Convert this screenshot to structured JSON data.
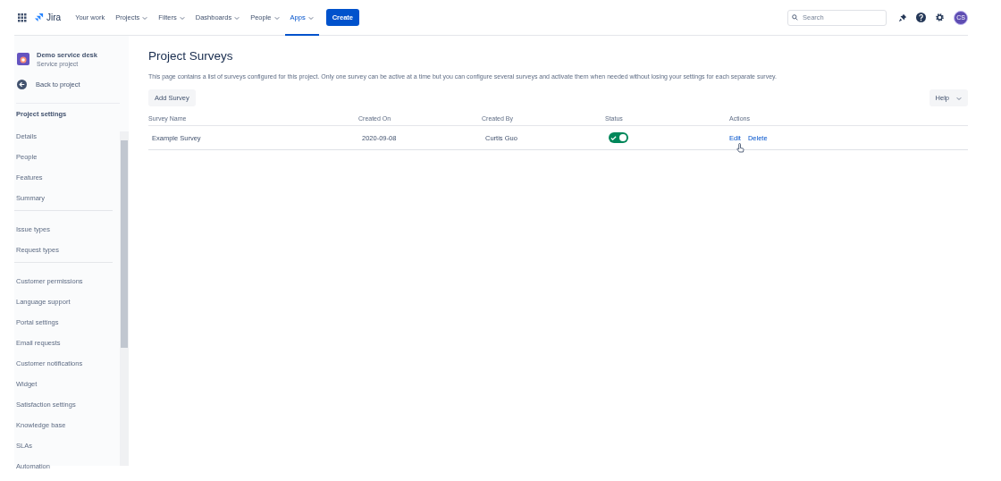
{
  "nav": {
    "logo": "Jira",
    "items": [
      {
        "label": "Your work",
        "has_menu": false,
        "selected": false
      },
      {
        "label": "Projects",
        "has_menu": true,
        "selected": false
      },
      {
        "label": "Filters",
        "has_menu": true,
        "selected": false
      },
      {
        "label": "Dashboards",
        "has_menu": true,
        "selected": false
      },
      {
        "label": "People",
        "has_menu": true,
        "selected": false
      },
      {
        "label": "Apps",
        "has_menu": true,
        "selected": true
      }
    ],
    "create": "Create",
    "search": {
      "placeholder": "Search"
    },
    "avatar": "CS"
  },
  "sidebar": {
    "project": {
      "name": "Demo service desk",
      "type": "Service project"
    },
    "back": "Back to project",
    "heading": "Project settings",
    "groups": [
      [
        "Details",
        "People",
        "Features",
        "Summary"
      ],
      [
        "Issue types",
        "Request types"
      ],
      [
        "Customer permissions",
        "Language support",
        "Portal settings",
        "Email requests",
        "Customer notifications",
        "Widget",
        "Satisfaction settings",
        "Knowledge base",
        "SLAs",
        "Automation"
      ]
    ]
  },
  "main": {
    "title": "Project Surveys",
    "description": "This page contains a list of surveys configured for this project. Only one survey can be active at a time but you can configure several surveys and activate them when needed without losing your settings for each separate survey.",
    "add_button": "Add Survey",
    "help_button": "Help",
    "table": {
      "columns": [
        "Survey Name",
        "Created On",
        "Created By",
        "Status",
        "Actions"
      ],
      "rows": [
        {
          "name": "Example Survey",
          "created_on": "2020-09-08",
          "created_by": "Curtis Guo",
          "on": true,
          "actions": [
            "Edit",
            "Delete"
          ]
        }
      ]
    }
  }
}
